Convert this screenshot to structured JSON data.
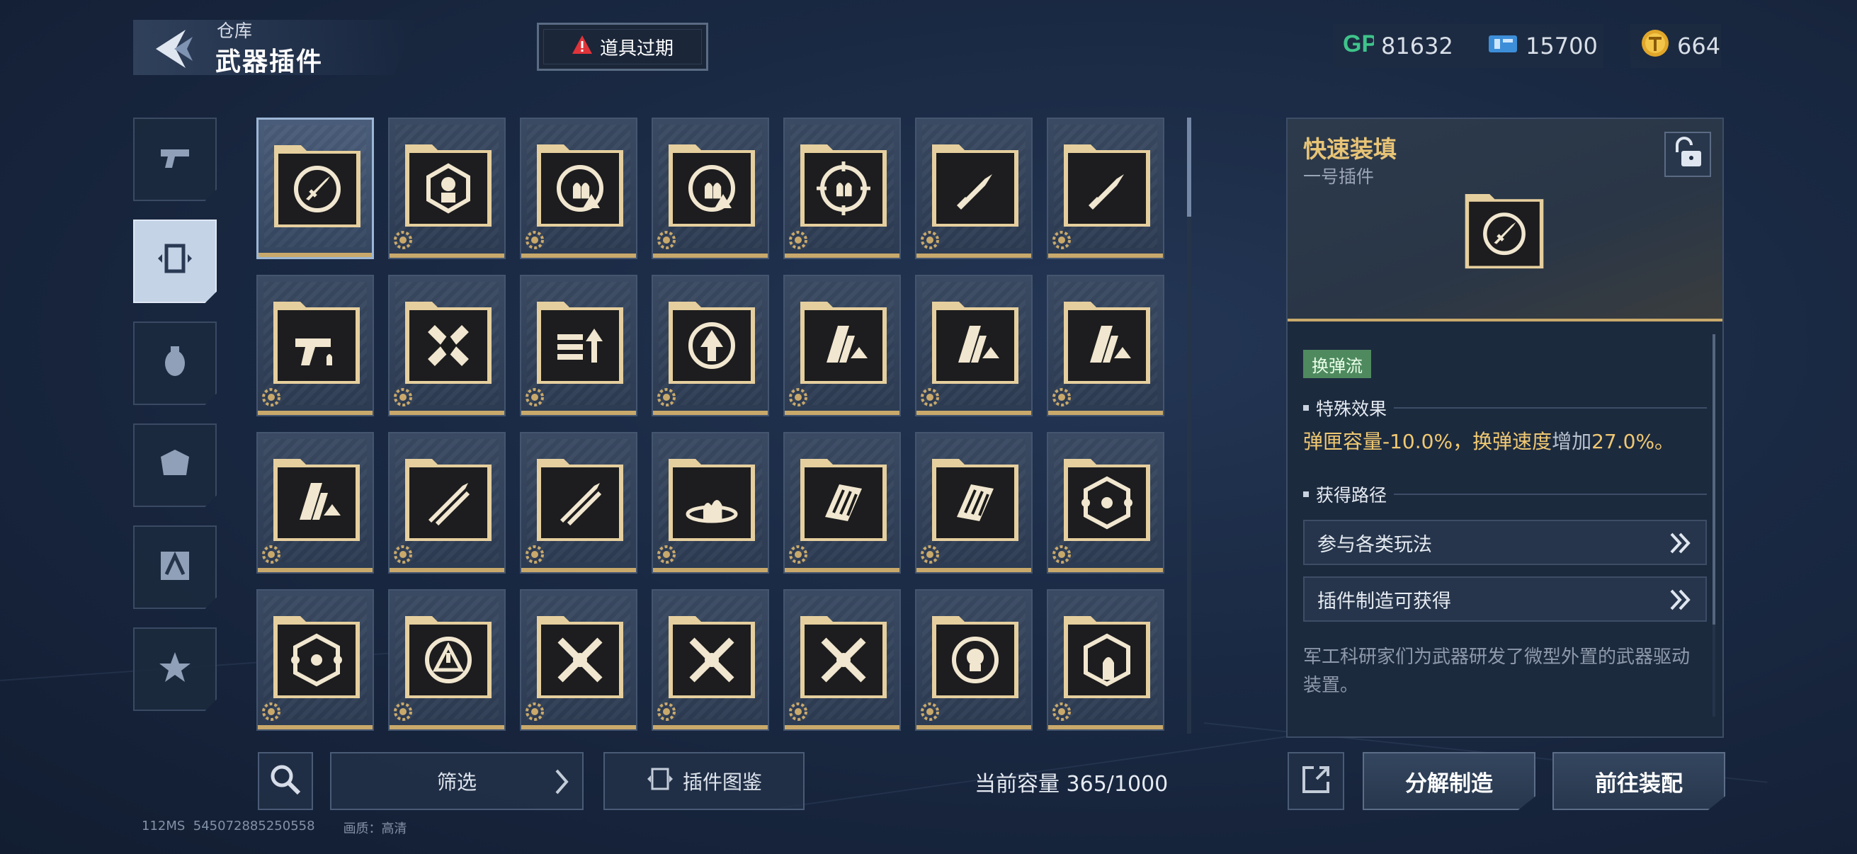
{
  "header": {
    "breadcrumb": "仓库",
    "title": "武器插件",
    "expire_button": "道具过期"
  },
  "currencies": {
    "gp": "81632",
    "ticket": "15700",
    "coin": "664"
  },
  "nav": {
    "items": [
      "pistol-icon",
      "plugin-icon",
      "grenade-icon",
      "armor-icon",
      "tool-icon",
      "star-icon"
    ],
    "active_index": 1
  },
  "grid": {
    "icons": [
      "rocket-reload-icon",
      "target-person-icon",
      "bullets-warning-icon",
      "bullets-warning-icon",
      "target-ammo-icon",
      "twin-bullets-icon",
      "twin-bullets-icon",
      "pistol-ammo-icon",
      "cross-shield-icon",
      "bullets-up-icon",
      "target-up-icon",
      "mag-up-icon",
      "mag-up-icon",
      "mag-up-icon",
      "mag-up-icon",
      "cross-bullets-icon",
      "cross-bullets-icon",
      "orbit-bullets-icon",
      "striped-ammo-icon",
      "striped-ammo-icon",
      "hex-network-icon",
      "hex-network-icon",
      "alert-circle-icon",
      "cross-swords-icon",
      "cross-swords-icon",
      "cross-swords-icon",
      "cycle-skull-icon",
      "hex-bullet-icon"
    ],
    "selected_index": 0
  },
  "bottom": {
    "filter_label": "筛选",
    "codex_label": "插件图鉴",
    "capacity_label": "当前容量 365/1000"
  },
  "footer": {
    "latency": "112MS",
    "uid": "545072885250558",
    "quality": "画质：高清"
  },
  "detail": {
    "name": "快速装填",
    "slot": "一号插件",
    "tag": "换弹流",
    "effect_heading": "特殊效果",
    "effect": {
      "part1": "弹匣容量",
      "part2": "-10.0%，",
      "part3": "换弹速度",
      "part4": "增加",
      "part5": "27.0%。"
    },
    "source_heading": "获得路径",
    "sources": [
      "参与各类玩法",
      "插件制造可获得"
    ],
    "description": "军工科研家们为武器研发了微型外置的武器驱动装置。"
  },
  "actions": {
    "decompose": "分解制造",
    "equip": "前往装配"
  },
  "colors": {
    "gold": "#e8c476",
    "tag_green": "#4f8a5f",
    "warning_red": "#e0343a"
  }
}
